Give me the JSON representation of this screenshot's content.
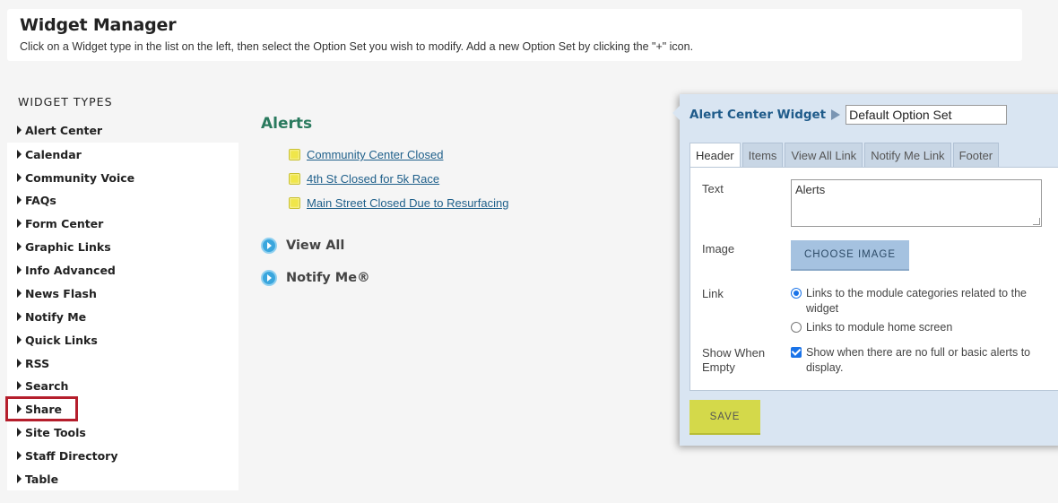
{
  "header": {
    "title": "Widget Manager",
    "instructions": "Click on a Widget type in the list on the left, then select the Option Set you wish to modify. Add a new Option Set by clicking the \"+\" icon."
  },
  "sidebar": {
    "title": "WIDGET TYPES",
    "items": [
      {
        "label": "Alert Center"
      },
      {
        "label": "Calendar"
      },
      {
        "label": "Community Voice"
      },
      {
        "label": "FAQs"
      },
      {
        "label": "Form Center"
      },
      {
        "label": "Graphic Links"
      },
      {
        "label": "Info Advanced"
      },
      {
        "label": "News Flash"
      },
      {
        "label": "Notify Me"
      },
      {
        "label": "Quick Links"
      },
      {
        "label": "RSS"
      },
      {
        "label": "Search"
      },
      {
        "label": "Share"
      },
      {
        "label": "Site Tools"
      },
      {
        "label": "Staff Directory"
      },
      {
        "label": "Table"
      }
    ],
    "highlighted": "Share"
  },
  "preview": {
    "title": "Alerts",
    "alerts": [
      {
        "label": "Community Center Closed"
      },
      {
        "label": "4th St Closed for 5k Race"
      },
      {
        "label": "Main Street Closed Due to Resurfacing"
      }
    ],
    "view_all": "View All",
    "notify_me": "Notify Me®"
  },
  "panel": {
    "widget_name": "Alert Center Widget",
    "option_set": "Default Option Set",
    "tabs": [
      {
        "label": "Header",
        "active": true
      },
      {
        "label": "Items"
      },
      {
        "label": "View All Link"
      },
      {
        "label": "Notify Me Link"
      },
      {
        "label": "Footer"
      }
    ],
    "fields": {
      "text_label": "Text",
      "text_value": "Alerts",
      "image_label": "Image",
      "choose_image": "CHOOSE IMAGE",
      "link_label": "Link",
      "link_option_1": "Links to the module categories related to the widget",
      "link_option_2": "Links to module home screen",
      "link_selected": 1,
      "show_when_empty_label": "Show When Empty",
      "show_when_empty_text": "Show when there are no full or basic alerts to display.",
      "show_when_empty_checked": true
    },
    "save": "SAVE"
  },
  "colors": {
    "accent_green": "#2a7a5e",
    "link_blue": "#1e5f8a",
    "highlight_red": "#b51e2c",
    "save_yellow": "#d4d94a",
    "panel_bg": "#d9e5f2"
  }
}
